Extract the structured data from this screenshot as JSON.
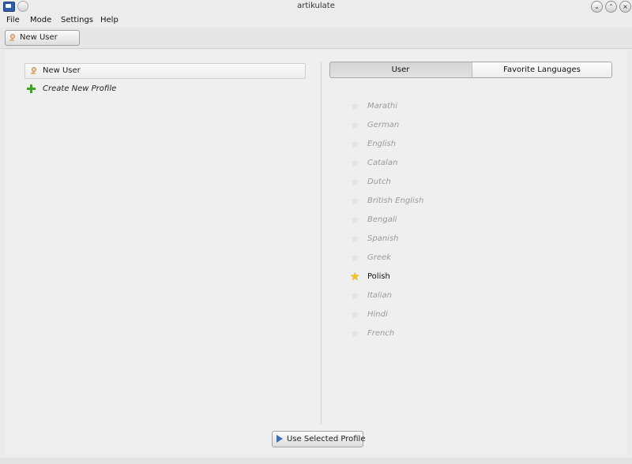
{
  "window": {
    "title": "artikulate",
    "controls": [
      "minimize-icon",
      "maximize-icon",
      "close-icon"
    ]
  },
  "menubar": {
    "items": [
      "File",
      "Mode",
      "Settings",
      "Help"
    ]
  },
  "toolbar": {
    "current_user_label": "New User"
  },
  "profiles": {
    "items": [
      {
        "name": "New User",
        "icon": "user-icon"
      }
    ],
    "create_label": "Create New Profile"
  },
  "tabs": {
    "items": [
      "User",
      "Favorite Languages"
    ],
    "active": "Favorite Languages"
  },
  "languages": [
    {
      "name": "Marathi",
      "favorite": false
    },
    {
      "name": "German",
      "favorite": false
    },
    {
      "name": "English",
      "favorite": false
    },
    {
      "name": "Catalan",
      "favorite": false
    },
    {
      "name": "Dutch",
      "favorite": false
    },
    {
      "name": "British English",
      "favorite": false
    },
    {
      "name": "Bengali",
      "favorite": false
    },
    {
      "name": "Spanish",
      "favorite": false
    },
    {
      "name": "Greek",
      "favorite": false
    },
    {
      "name": "Polish",
      "favorite": true
    },
    {
      "name": "Italian",
      "favorite": false
    },
    {
      "name": "Hindi",
      "favorite": false
    },
    {
      "name": "French",
      "favorite": false
    }
  ],
  "actions": {
    "use_selected_profile_label": "Use Selected Profile"
  },
  "colors": {
    "favorite_star": "#f5c518",
    "accent": "#3e6fb6"
  }
}
